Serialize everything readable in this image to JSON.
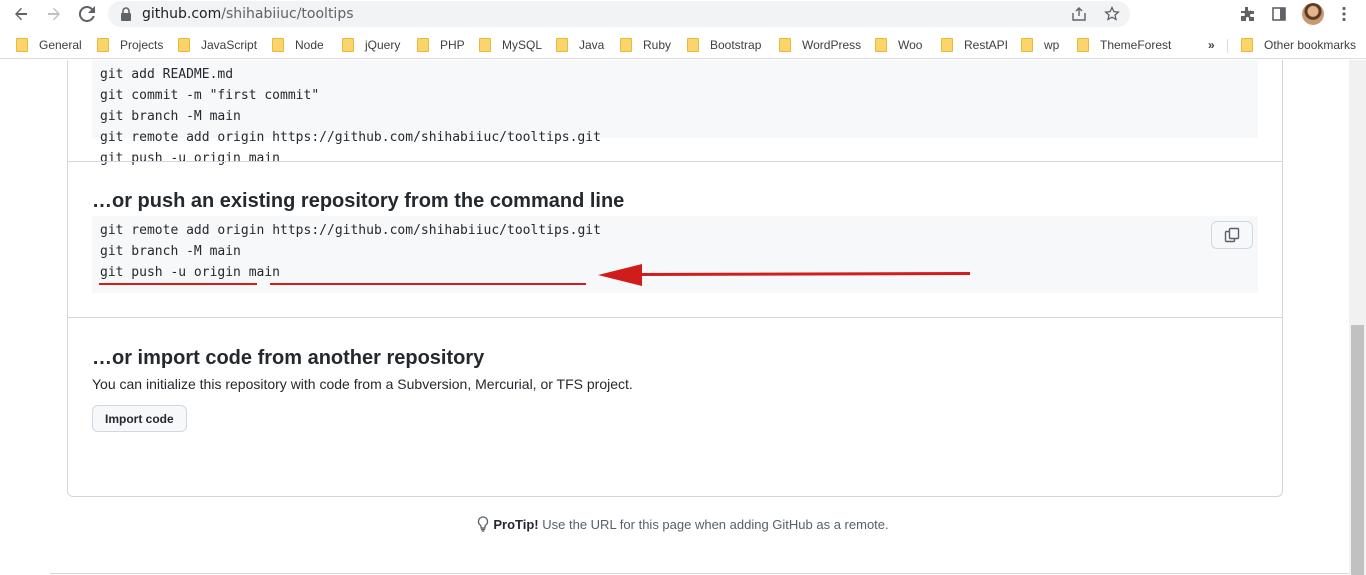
{
  "browser": {
    "url_host": "github.com",
    "url_path": "/shihabiiuc/tooltips",
    "bookmarks": [
      "General",
      "Projects",
      "JavaScript",
      "Node",
      "jQuery",
      "PHP",
      "MySQL",
      "Java",
      "Ruby",
      "Bootstrap",
      "WordPress",
      "Woo",
      "RestAPI",
      "wp",
      "ThemeForest"
    ],
    "overflow_label": "»",
    "other_bookmarks": "Other bookmarks",
    "icons": [
      "back-icon",
      "forward-icon",
      "reload-icon",
      "lock-icon",
      "share-icon",
      "star-icon",
      "extensions-icon",
      "sidepanel-icon",
      "avatar",
      "menu-icon"
    ]
  },
  "page": {
    "create_code": [
      "git add README.md",
      "git commit -m \"first commit\"",
      "git branch -M main",
      "git remote add origin https://github.com/shihabiiuc/tooltips.git",
      "git push -u origin main"
    ],
    "push_title": "…or push an existing repository from the command line",
    "push_code": {
      "line1_cmd": "git remote add origin",
      "line1_url": "https://github.com/shihabiiuc/tooltips.git",
      "line2": "git branch -M main",
      "line3": "git push -u origin main"
    },
    "import_title": "…or import code from another repository",
    "import_desc": "You can initialize this repository with code from a Subversion, Mercurial, or TFS project.",
    "import_button": "Import code",
    "protip_label": "ProTip!",
    "protip_text": " Use the URL for this page when adding GitHub as a remote."
  },
  "annotation": {
    "color": "#d11c1c"
  }
}
